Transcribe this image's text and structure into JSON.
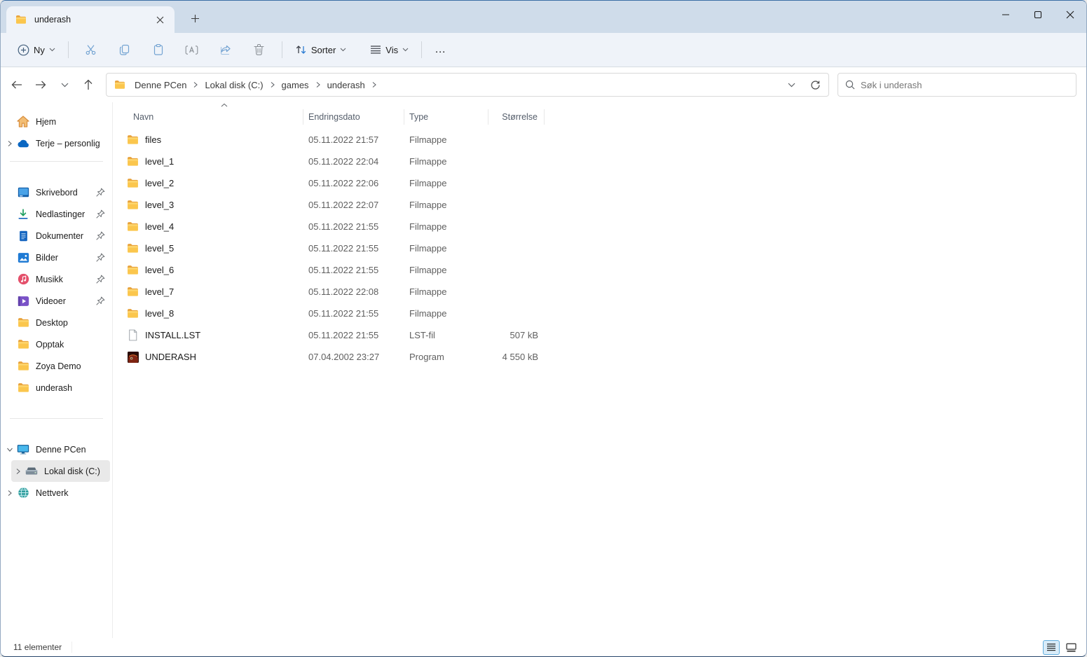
{
  "window": {
    "title": "underash"
  },
  "tab": {
    "label": "underash"
  },
  "toolbar": {
    "new_label": "Ny",
    "sort_label": "Sorter",
    "view_label": "Vis",
    "more_label": "…"
  },
  "addressbar": {
    "crumbs": [
      "Denne PCen",
      "Lokal disk (C:)",
      "games",
      "underash"
    ]
  },
  "search": {
    "placeholder": "Søk i underash"
  },
  "sidebar": {
    "top": [
      {
        "label": "Hjem",
        "icon": "home",
        "chevron": "",
        "pinned": false
      },
      {
        "label": "Terje – personlig",
        "icon": "onedrive",
        "chevron": "right",
        "pinned": false
      }
    ],
    "pinned": [
      {
        "label": "Skrivebord",
        "icon": "desktop",
        "chevron": "",
        "pinned": true
      },
      {
        "label": "Nedlastinger",
        "icon": "downloads",
        "chevron": "",
        "pinned": true
      },
      {
        "label": "Dokumenter",
        "icon": "documents",
        "chevron": "",
        "pinned": true
      },
      {
        "label": "Bilder",
        "icon": "pictures",
        "chevron": "",
        "pinned": true
      },
      {
        "label": "Musikk",
        "icon": "music",
        "chevron": "",
        "pinned": true
      },
      {
        "label": "Videoer",
        "icon": "videos",
        "chevron": "",
        "pinned": true
      },
      {
        "label": "Desktop",
        "icon": "folder",
        "chevron": "",
        "pinned": false
      },
      {
        "label": "Opptak",
        "icon": "folder",
        "chevron": "",
        "pinned": false
      },
      {
        "label": "Zoya Demo",
        "icon": "folder",
        "chevron": "",
        "pinned": false
      },
      {
        "label": "underash",
        "icon": "folder",
        "chevron": "",
        "pinned": false
      }
    ],
    "tree": [
      {
        "label": "Denne PCen",
        "icon": "computer",
        "chevron": "down",
        "indent": 0,
        "selected": false
      },
      {
        "label": "Lokal disk (C:)",
        "icon": "drive",
        "chevron": "right",
        "indent": 1,
        "selected": true
      },
      {
        "label": "Nettverk",
        "icon": "network",
        "chevron": "right",
        "indent": 0,
        "selected": false
      }
    ]
  },
  "list": {
    "columns": [
      "Navn",
      "Endringsdato",
      "Type",
      "Størrelse"
    ],
    "sort_column": "Navn",
    "sort_direction": "ascending",
    "rows": [
      {
        "name": "files",
        "date": "05.11.2022 21:57",
        "type": "Filmappe",
        "size": "",
        "icon": "folder"
      },
      {
        "name": "level_1",
        "date": "05.11.2022 22:04",
        "type": "Filmappe",
        "size": "",
        "icon": "folder"
      },
      {
        "name": "level_2",
        "date": "05.11.2022 22:06",
        "type": "Filmappe",
        "size": "",
        "icon": "folder"
      },
      {
        "name": "level_3",
        "date": "05.11.2022 22:07",
        "type": "Filmappe",
        "size": "",
        "icon": "folder"
      },
      {
        "name": "level_4",
        "date": "05.11.2022 21:55",
        "type": "Filmappe",
        "size": "",
        "icon": "folder"
      },
      {
        "name": "level_5",
        "date": "05.11.2022 21:55",
        "type": "Filmappe",
        "size": "",
        "icon": "folder"
      },
      {
        "name": "level_6",
        "date": "05.11.2022 21:55",
        "type": "Filmappe",
        "size": "",
        "icon": "folder"
      },
      {
        "name": "level_7",
        "date": "05.11.2022 22:08",
        "type": "Filmappe",
        "size": "",
        "icon": "folder"
      },
      {
        "name": "level_8",
        "date": "05.11.2022 21:55",
        "type": "Filmappe",
        "size": "",
        "icon": "folder"
      },
      {
        "name": "INSTALL.LST",
        "date": "05.11.2022 21:55",
        "type": "LST-fil",
        "size": "507 kB",
        "icon": "file"
      },
      {
        "name": "UNDERASH",
        "date": "07.04.2002 23:27",
        "type": "Program",
        "size": "4 550 kB",
        "icon": "app"
      }
    ]
  },
  "statusbar": {
    "count": "11 elementer"
  }
}
